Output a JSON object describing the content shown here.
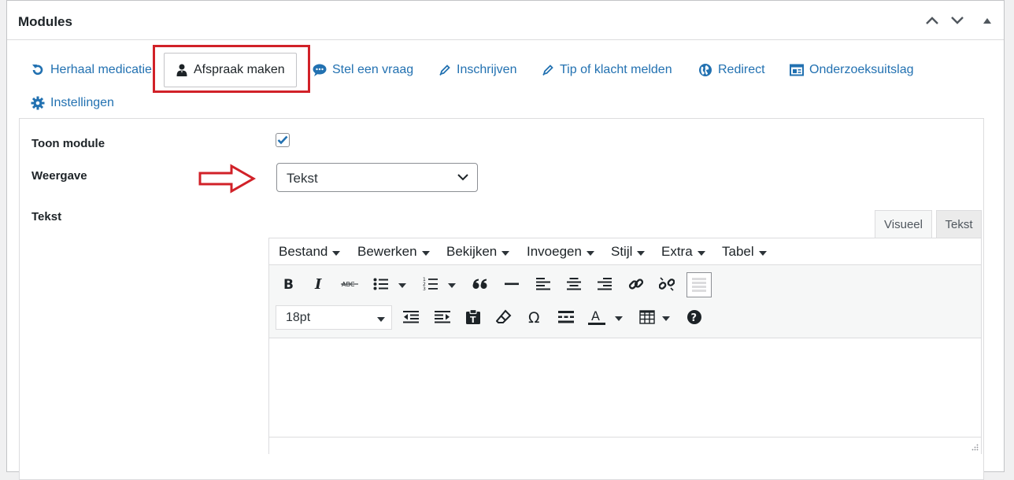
{
  "panel": {
    "title": "Modules",
    "header_buttons": [
      "chevron-up-icon",
      "chevron-down-icon",
      "triangle-up-icon"
    ]
  },
  "tabs": [
    {
      "label": "Herhaal medicatie",
      "icon": "refresh-icon",
      "active": false
    },
    {
      "label": "Afspraak maken",
      "icon": "person-icon",
      "active": true
    },
    {
      "label": "Stel een vraag",
      "icon": "speech-bubble-icon",
      "active": false
    },
    {
      "label": "Inschrijven",
      "icon": "pencil-icon",
      "active": false
    },
    {
      "label": "Tip of klacht melden",
      "icon": "pencil-icon",
      "active": false
    },
    {
      "label": "Redirect",
      "icon": "globe-icon",
      "active": false
    },
    {
      "label": "Onderzoeksuitslag",
      "icon": "document-icon",
      "active": false
    },
    {
      "label": "Instellingen",
      "icon": "gear-icon",
      "active": false
    }
  ],
  "form": {
    "toon_module_label": "Toon module",
    "toon_module_checked": true,
    "weergave_label": "Weergave",
    "weergave_value": "Tekst",
    "tekst_label": "Tekst"
  },
  "editor": {
    "tab_visual": "Visueel",
    "tab_text": "Tekst",
    "menu": [
      "Bestand",
      "Bewerken",
      "Bekijken",
      "Invoegen",
      "Stijl",
      "Extra",
      "Tabel"
    ],
    "font_size": "18pt",
    "toolbar_row1": [
      "bold-icon",
      "italic-icon",
      "strikethrough-icon",
      "bullet-list-icon",
      "numbered-list-icon",
      "blockquote-icon",
      "horizontal-line-icon",
      "align-left-icon",
      "align-center-icon",
      "align-right-icon",
      "link-icon",
      "unlink-icon",
      "toolbar-toggle-icon"
    ],
    "toolbar_row2": [
      "outdent-icon",
      "indent-icon",
      "paste-text-icon",
      "clear-formatting-icon",
      "special-character-icon",
      "read-more-icon",
      "text-color-icon",
      "table-icon",
      "help-icon"
    ]
  },
  "colors": {
    "link": "#2271b1",
    "annotation": "#d12128",
    "border": "#c3c4c7"
  }
}
